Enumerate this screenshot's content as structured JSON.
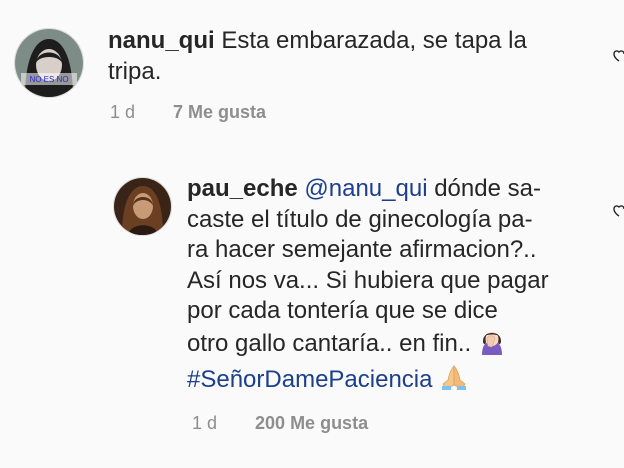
{
  "comments": [
    {
      "avatar_caption": "NO ES NO",
      "username": "nanu_qui",
      "text_line1": "Esta embarazada, se tapa la",
      "text_line2": "tripa.",
      "time": "1 d",
      "likes": "7 Me gusta"
    },
    {
      "username": "pau_eche",
      "mention": "@nanu_qui",
      "text_line1": " dónde sa-",
      "lines": [
        "caste el título de ginecología pa-",
        "ra hacer semejante afirmacion?..",
        "Así nos va... Si hubiera que pagar",
        "por cada tontería que se dice",
        "otro gallo cantaría.. en fin.."
      ],
      "hashtag": "#SeñorDamePaciencia",
      "emoji_1": "woman-facepalming-icon",
      "emoji_2": "folded-hands-icon",
      "time": "1 d",
      "likes": "200 Me gusta"
    }
  ],
  "colors": {
    "background": "#fafafa",
    "text": "#262626",
    "link": "#1c3f8c",
    "meta": "#8e8e8e"
  }
}
